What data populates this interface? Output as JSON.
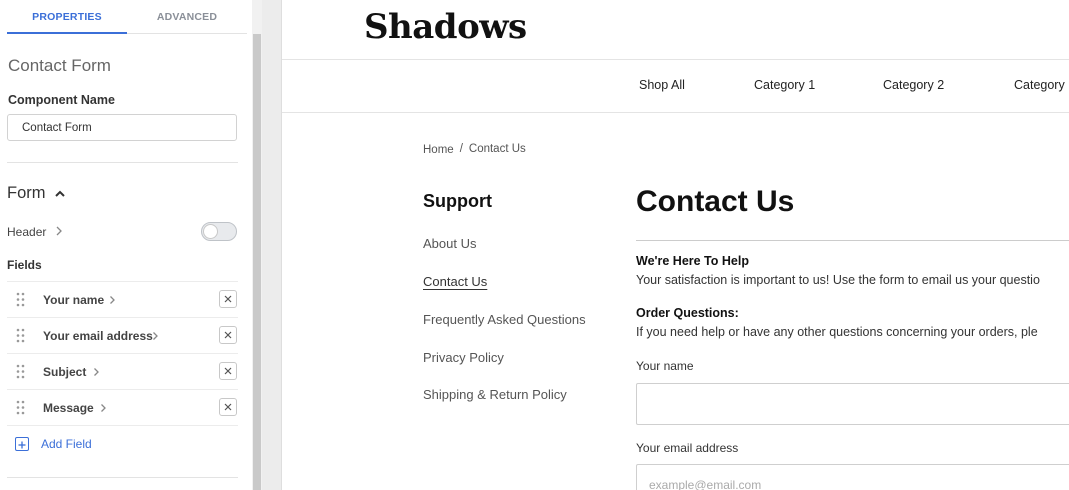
{
  "panel": {
    "tabs": [
      {
        "label": "PROPERTIES",
        "active": true
      },
      {
        "label": "ADVANCED",
        "active": false
      }
    ],
    "title": "Contact Form",
    "component_name_label": "Component Name",
    "component_name_value": "Contact Form",
    "form_section_label": "Form",
    "header_label": "Header",
    "header_toggle_on": false,
    "fields_label": "Fields",
    "fields": [
      {
        "label": "Your name"
      },
      {
        "label": "Your email address"
      },
      {
        "label": "Subject"
      },
      {
        "label": "Message"
      }
    ],
    "add_field_label": "Add Field",
    "accent_color": "#3b6fd8"
  },
  "preview": {
    "logo": "Shadows",
    "nav": [
      "Shop All",
      "Category 1",
      "Category 2",
      "Category"
    ],
    "breadcrumb": {
      "home": "Home",
      "separator": "/",
      "current": "Contact Us"
    },
    "sidebar": {
      "title": "Support",
      "links": [
        {
          "label": "About Us",
          "active": false
        },
        {
          "label": "Contact Us",
          "active": true
        },
        {
          "label": "Frequently Asked Questions",
          "active": false
        },
        {
          "label": "Privacy Policy",
          "active": false
        },
        {
          "label": "Shipping & Return Policy",
          "active": false
        }
      ]
    },
    "page_title": "Contact Us",
    "sections": [
      {
        "title": "We're Here To Help",
        "text": "Your satisfaction is important to us! Use the form to email us your questio"
      },
      {
        "title": "Order Questions:",
        "text": "If you need help or have any other questions concerning your orders, ple"
      }
    ],
    "form": {
      "name_label": "Your name",
      "name_placeholder": "",
      "email_label": "Your email address",
      "email_placeholder": "example@email.com"
    }
  }
}
